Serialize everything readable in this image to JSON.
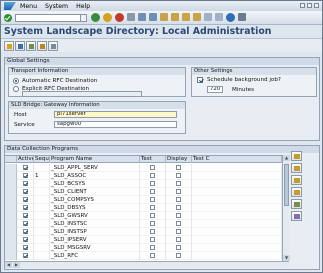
{
  "menubar": {
    "items": [
      "Menu",
      "System",
      "Help"
    ]
  },
  "page": {
    "title": "System Landscape Directory: Local Administration"
  },
  "global_settings": {
    "title": "Global Settings",
    "transport": {
      "title": "Transport Information",
      "automatic_label": "Automatic RFC Destination",
      "explicit_label": "Explicit RFC Destination",
      "selected": "automatic",
      "explicit_value": ""
    },
    "gateway": {
      "title": "SLD Bridge: Gateway Information",
      "host_label": "Host",
      "host_value": "pi71server",
      "service_label": "Service",
      "service_value": "sapgw00"
    },
    "other": {
      "title": "Other Settings",
      "schedule_label": "Schedule background job?",
      "schedule_checked": true,
      "minutes_value": "720",
      "minutes_label": "Minutes"
    }
  },
  "programs": {
    "title": "Data Collection Programs",
    "headers": [
      "Active",
      "Seque",
      "Program Name",
      "Test",
      "Display",
      "Test C"
    ],
    "rows": [
      {
        "active": true,
        "seq": "",
        "name": "_SLD_APPL_SERV",
        "test": false,
        "display": false
      },
      {
        "active": true,
        "seq": "1",
        "name": "_SLD_ASSOC",
        "test": false,
        "display": false
      },
      {
        "active": true,
        "seq": "",
        "name": "_SLD_BCSYS",
        "test": false,
        "display": false
      },
      {
        "active": true,
        "seq": "",
        "name": "_SLD_CLIENT",
        "test": false,
        "display": false
      },
      {
        "active": true,
        "seq": "",
        "name": "_SLD_COMPSYS",
        "test": false,
        "display": false
      },
      {
        "active": true,
        "seq": "",
        "name": "_SLD_DBSYS",
        "test": false,
        "display": false
      },
      {
        "active": true,
        "seq": "",
        "name": "_SLD_GWSRV",
        "test": false,
        "display": false
      },
      {
        "active": true,
        "seq": "",
        "name": "_SLD_INSTSC",
        "test": false,
        "display": false
      },
      {
        "active": true,
        "seq": "",
        "name": "_SLD_INSTSP",
        "test": false,
        "display": false
      },
      {
        "active": true,
        "seq": "",
        "name": "_SLD_IPSERV",
        "test": false,
        "display": false
      },
      {
        "active": true,
        "seq": "",
        "name": "_SLD_MSGSRV",
        "test": false,
        "display": false
      },
      {
        "active": true,
        "seq": "",
        "name": "_SLD_RFC",
        "test": false,
        "display": false
      }
    ]
  },
  "icons": {
    "toolbar": [
      "back-icon",
      "exit-icon",
      "cancel-icon",
      "print-icon",
      "find-icon",
      "find-next-icon",
      "first-page-icon",
      "prev-page-icon",
      "next-page-icon",
      "last-page-icon",
      "new-session-icon",
      "shortcut-icon",
      "help-icon",
      "layout-icon"
    ],
    "app_toolbar": [
      "display-change-icon",
      "save-icon",
      "details-icon",
      "execute-icon",
      "settings-icon"
    ],
    "table_tools": [
      "select-all-icon",
      "deselect-all-icon",
      "sort-icon",
      "filter-icon",
      "details-icon",
      "configure-icon"
    ]
  },
  "colors": {
    "title": "#2b4873",
    "background": "#dfe6ee",
    "accent": "#1b62b0"
  }
}
